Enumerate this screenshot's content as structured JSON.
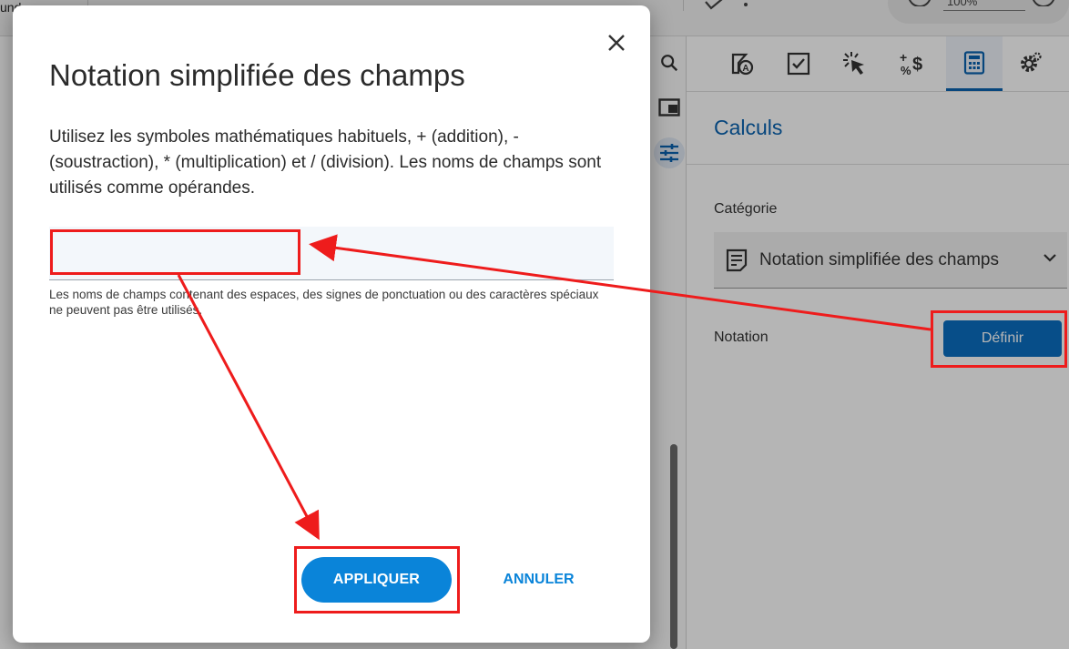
{
  "app": {
    "zoom_value": "100%",
    "topbar_fragment": "und"
  },
  "panel": {
    "title": "Calculs",
    "category_label": "Catégorie",
    "category_value": "Notation simplifiée des champs",
    "notation_label": "Notation",
    "define_button": "Définir",
    "tabs": [
      "form-field-icon",
      "checkbox-icon",
      "cursor-click-icon",
      "currency-percent-icon",
      "calculator-icon",
      "gear-icon"
    ]
  },
  "dialog": {
    "title": "Notation simplifiée des champs",
    "description": "Utilisez les symboles mathématiques habituels, + (addition), - (soustraction), * (multiplication) et / (division). Les noms de champs sont utilisés comme opérandes.",
    "field_value": "",
    "hint": "Les noms de champs contenant des espaces, des signes de ponctuation ou des caractères spéciaux ne peuvent pas être utilisés.",
    "apply_button": "APPLIQUER",
    "cancel_button": "ANNULER"
  },
  "colors": {
    "accent": "#0a84d9",
    "panel_accent": "#0a63b0",
    "annotation": "#ee1c1c"
  }
}
